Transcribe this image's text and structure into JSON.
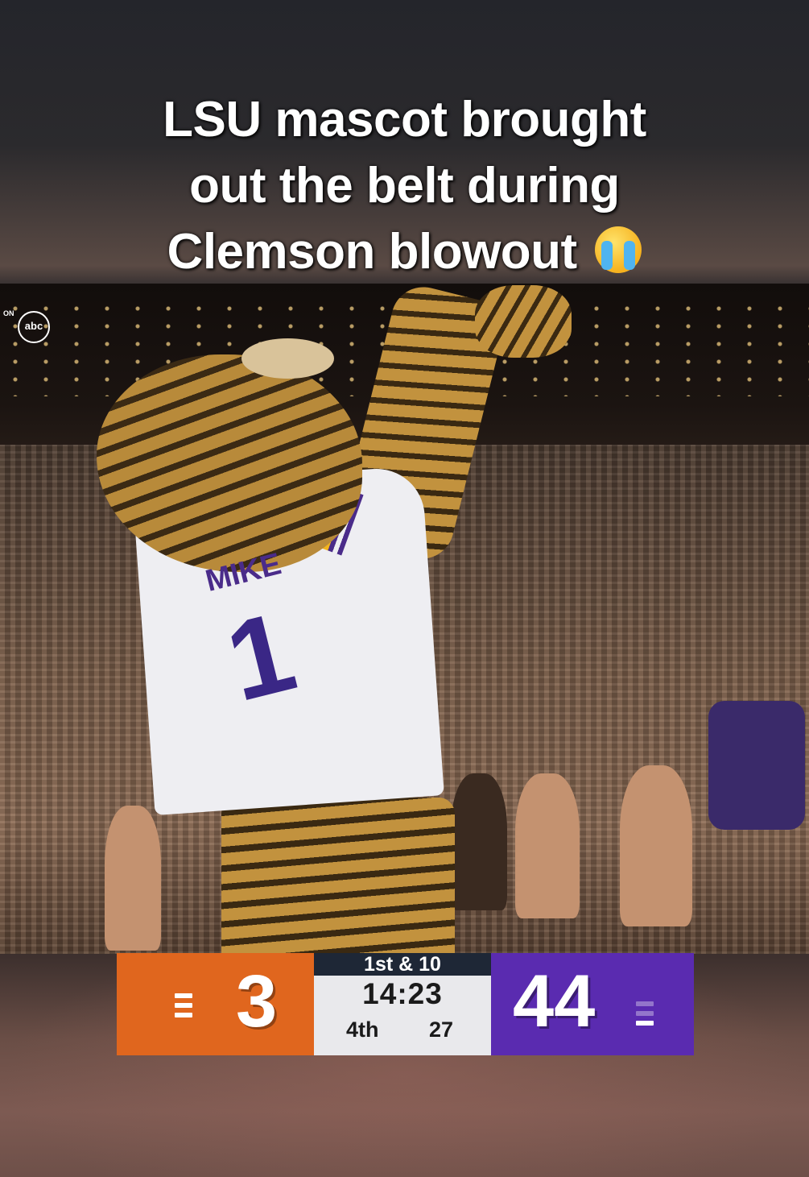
{
  "caption": {
    "line1": "LSU mascot brought",
    "line2": "out the belt during",
    "line3": "Clemson blowout",
    "emoji": "loudly-crying-face"
  },
  "broadcast": {
    "network_prefix": "ON",
    "network": "abc"
  },
  "mascot": {
    "jersey_name": "MIKE",
    "jersey_number": "1"
  },
  "scoreboard": {
    "away_score": "3",
    "home_score": "44",
    "down_distance": "1st & 10",
    "clock": "14:23",
    "quarter": "4th",
    "play_clock": "27",
    "away_color": "#e0661e",
    "home_color": "#5a2bb0"
  }
}
